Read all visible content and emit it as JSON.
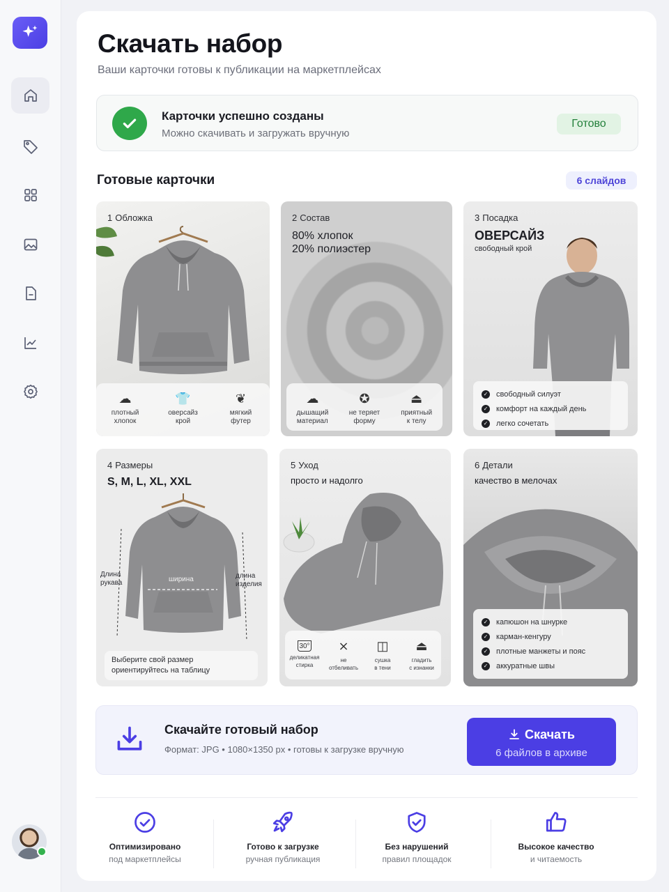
{
  "brand": {
    "accent": "#4b3ee4",
    "success": "#2fa84a",
    "logo_icon": "sparkles-icon"
  },
  "sidebar": {
    "items": [
      {
        "icon": "home-icon",
        "active": true
      },
      {
        "icon": "tag-icon"
      },
      {
        "icon": "grid-icon"
      },
      {
        "icon": "image-icon"
      },
      {
        "icon": "document-icon"
      },
      {
        "icon": "chart-icon"
      },
      {
        "icon": "settings-icon"
      }
    ],
    "user_status": "online"
  },
  "header": {
    "title": "Скачать набор",
    "subtitle": "Ваши карточки готовы к публикации на маркетплейсах"
  },
  "status": {
    "title": "Карточки успешно созданы",
    "text": "Можно скачивать и загружать вручную",
    "badge": "Готово"
  },
  "cards_section": {
    "title": "Готовые карточки",
    "count_badge": "6 слайдов"
  },
  "cards": [
    {
      "number": "1",
      "label": "Обложка",
      "features": [
        {
          "icon": "cloud-icon",
          "line1": "плотный",
          "line2": "хлопок"
        },
        {
          "icon": "shirt-icon",
          "line1": "оверсайз",
          "line2": "крой"
        },
        {
          "icon": "leaf-icon",
          "line1": "мягкий",
          "line2": "футер"
        }
      ]
    },
    {
      "number": "2",
      "label": "Состав",
      "line1": "80% хлопок",
      "line2": "20% полиэстер",
      "features": [
        {
          "icon": "cloud-icon",
          "line1": "дышащий",
          "line2": "материал"
        },
        {
          "icon": "badge-check-icon",
          "line1": "не теряет",
          "line2": "форму"
        },
        {
          "icon": "iron-icon",
          "line1": "приятный",
          "line2": "к телу"
        }
      ]
    },
    {
      "number": "3",
      "label": "Посадка",
      "headline": "ОВЕРСАЙЗ",
      "subline": "свободный крой",
      "checks": [
        "свободный силуэт",
        "комфорт на каждый день",
        "легко сочетать"
      ]
    },
    {
      "number": "4",
      "label": "Размеры",
      "headline": "S, M, L, XL, XXL",
      "dims": {
        "sleeve1": "Длина",
        "sleeve2": "рукава",
        "width": "ширина",
        "length1": "длина",
        "length2": "изделия"
      },
      "note1": "Выберите свой размер",
      "note2": "ориентируйтесь на таблицу"
    },
    {
      "number": "5",
      "label": "Уход",
      "subline": "просто и надолго",
      "care": [
        {
          "icon": "wash-30-icon",
          "symbol": "30°",
          "line1": "деликатная",
          "line2": "стирка"
        },
        {
          "icon": "no-bleach-icon",
          "symbol": "",
          "line1": "не",
          "line2": "отбеливать"
        },
        {
          "icon": "shade-dry-icon",
          "symbol": "",
          "line1": "сушка",
          "line2": "в тени"
        },
        {
          "icon": "iron-low-icon",
          "symbol": "",
          "line1": "гладить",
          "line2": "с изнанки"
        }
      ]
    },
    {
      "number": "6",
      "label": "Детали",
      "subline": "качество в мелочах",
      "checks": [
        "капюшон на шнурке",
        "карман-кенгуру",
        "плотные манжеты и пояс",
        "аккуратные швы"
      ]
    }
  ],
  "download": {
    "title": "Скачайте готовый набор",
    "meta": "Формат: JPG  •  1080×1350 px  •  готовы к загрузке вручную",
    "button_label": "Скачать",
    "button_sub": "6 файлов в архиве"
  },
  "features": [
    {
      "icon": "check-circle-icon",
      "title": "Оптимизировано",
      "text": "под маркетплейсы"
    },
    {
      "icon": "rocket-icon",
      "title": "Готово к загрузке",
      "text": "ручная публикация"
    },
    {
      "icon": "shield-check-icon",
      "title": "Без нарушений",
      "text": "правил площадок"
    },
    {
      "icon": "thumbs-up-icon",
      "title": "Высокое качество",
      "text": "и читаемость"
    }
  ]
}
